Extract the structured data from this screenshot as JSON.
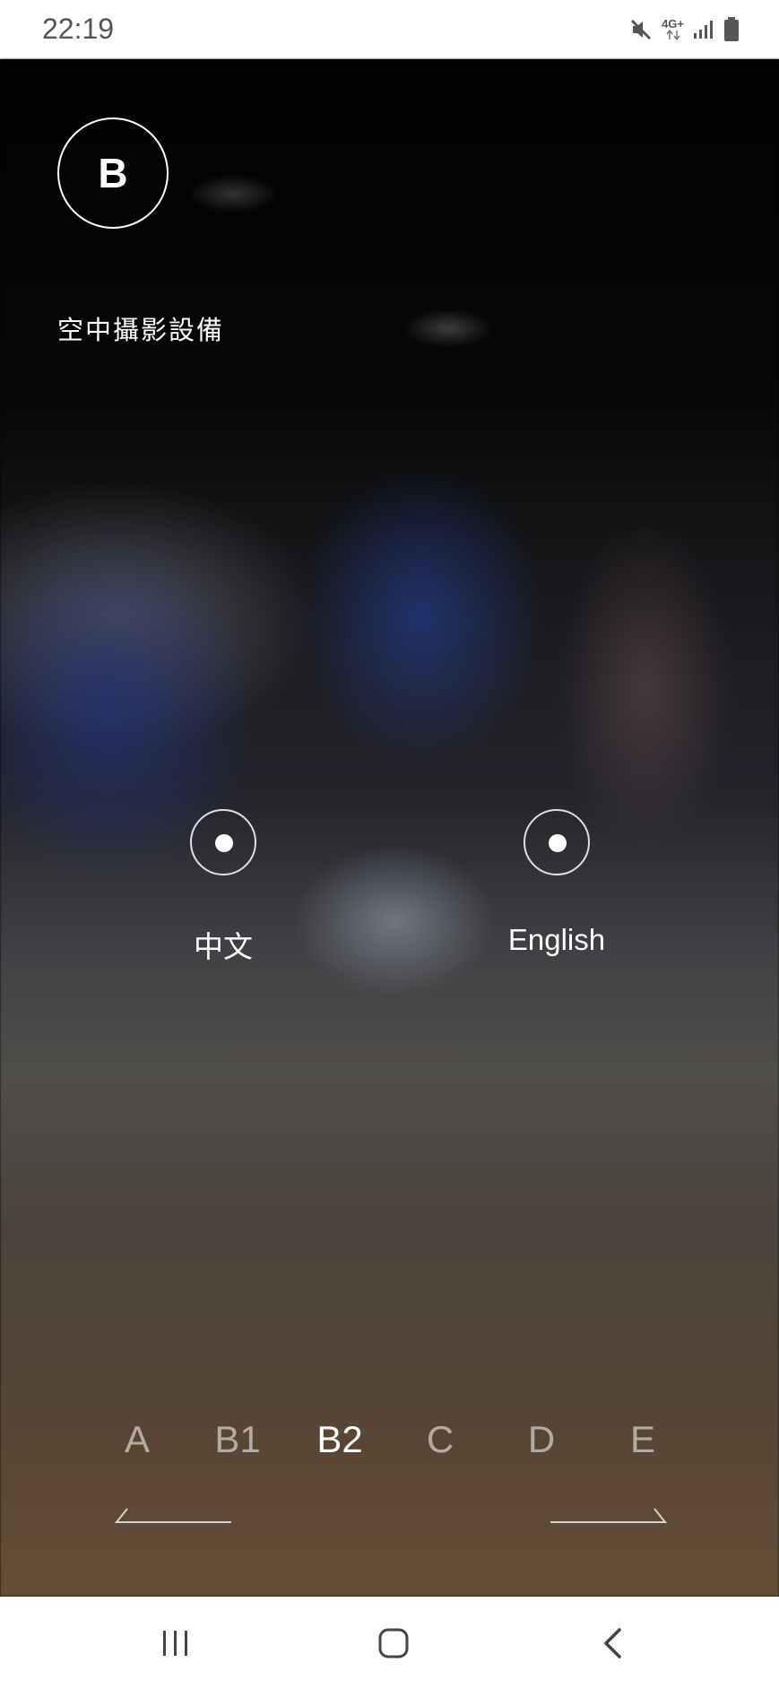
{
  "status_bar": {
    "time": "22:19",
    "network_label": "4G+",
    "icons": [
      "mute-icon",
      "network-4g-icon",
      "signal-icon",
      "battery-icon"
    ]
  },
  "zone": {
    "badge_letter": "B",
    "title": "空中攝影設備"
  },
  "languages": [
    {
      "label": "中文"
    },
    {
      "label": "English"
    }
  ],
  "zone_tabs": {
    "items": [
      "A",
      "B1",
      "B2",
      "C",
      "D",
      "E"
    ],
    "selected": "B2"
  },
  "nav_bar": {
    "icons": [
      "recent-apps-icon",
      "home-icon",
      "back-icon"
    ]
  },
  "colors": {
    "foreground": "#ffffff",
    "inactive_tab": "#ffffff8c",
    "status_bar_bg": "#ffffff",
    "nav_bar_bg": "#ffffff"
  }
}
